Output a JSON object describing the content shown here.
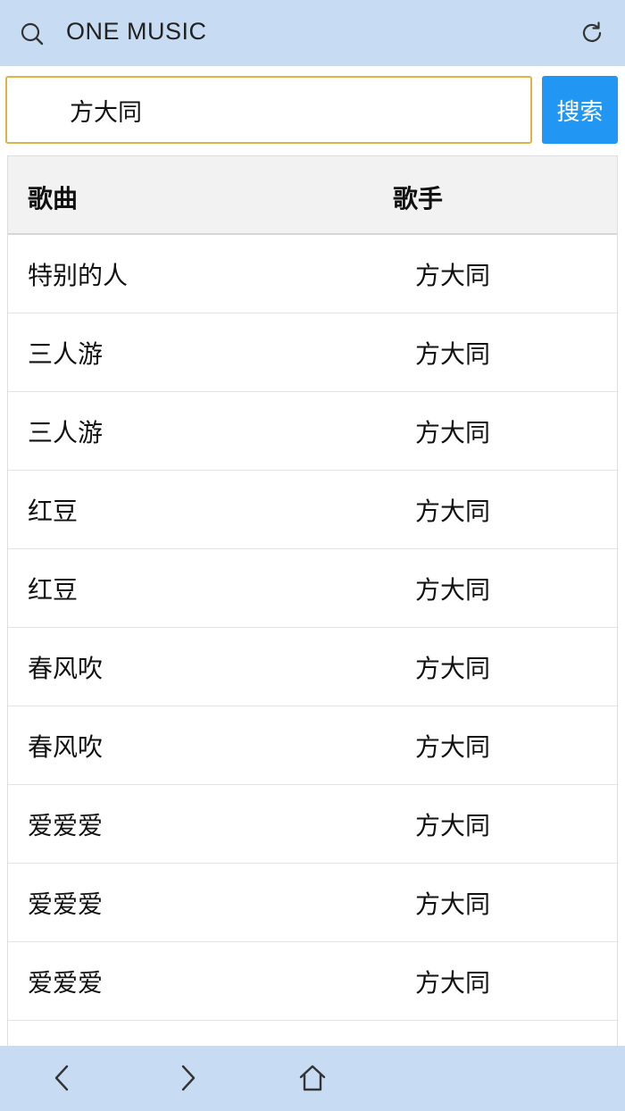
{
  "header": {
    "title": "ONE MUSIC",
    "search_icon": "search-icon",
    "refresh_icon": "refresh-icon"
  },
  "search": {
    "value": "方大同",
    "button_label": "搜索"
  },
  "table": {
    "columns": [
      "歌曲",
      "歌手"
    ],
    "rows": [
      {
        "song": "特别的人",
        "singer": "方大同"
      },
      {
        "song": "三人游",
        "singer": "方大同"
      },
      {
        "song": "三人游",
        "singer": "方大同"
      },
      {
        "song": "红豆",
        "singer": "方大同"
      },
      {
        "song": "红豆",
        "singer": "方大同"
      },
      {
        "song": "春风吹",
        "singer": "方大同"
      },
      {
        "song": "春风吹",
        "singer": "方大同"
      },
      {
        "song": "爱爱爱",
        "singer": "方大同"
      },
      {
        "song": "爱爱爱",
        "singer": "方大同"
      },
      {
        "song": "爱爱爱",
        "singer": "方大同"
      }
    ]
  },
  "navbar": {
    "items": [
      "back-icon",
      "forward-icon",
      "home-icon"
    ]
  },
  "colors": {
    "bar": "#c7dcf2",
    "accent": "#2196f3",
    "input_border": "#e0b24a"
  }
}
